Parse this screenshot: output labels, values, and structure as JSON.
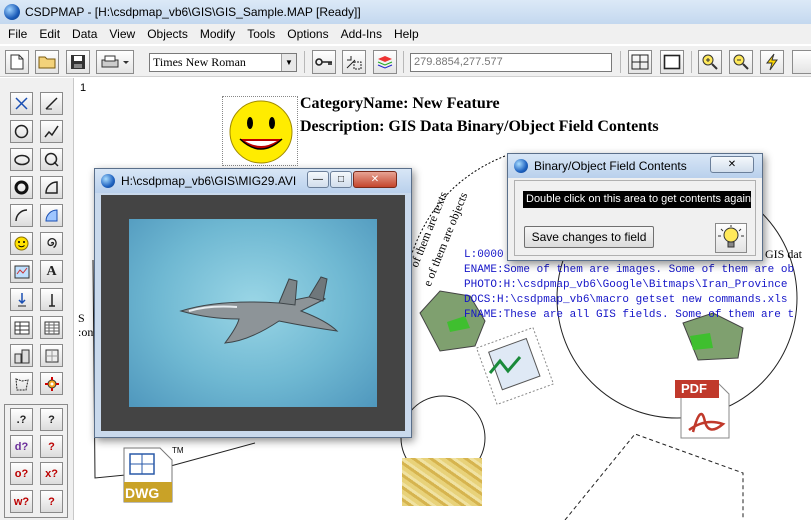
{
  "window": {
    "title": "CSDPMAP - [H:\\csdpmap_vb6\\GIS\\GIS_Sample.MAP [Ready]]"
  },
  "menu": [
    "File",
    "Edit",
    "Data",
    "View",
    "Objects",
    "Modify",
    "Tools",
    "Options",
    "Add-Ins",
    "Help"
  ],
  "toolbar": {
    "font_name": "Times New Roman",
    "coordinates": "279.8854,277.577",
    "buttons": [
      "new-doc-icon",
      "open-folder-icon",
      "save-icon",
      "print-icon",
      "key-icon",
      "select-tool-icon",
      "layers-icon",
      "grid-icon",
      "page-icon",
      "zoom-in-icon",
      "zoom-out-icon",
      "lightning-icon"
    ]
  },
  "palette": {
    "row_icons": [
      "select-x-icon",
      "line-icon",
      "circle-icon",
      "polyline-icon",
      "ellipse-icon",
      "q-shape-icon",
      "ring-icon",
      "arc-fill-icon",
      "arc-icon",
      "protractor-icon",
      "smiley-icon",
      "spiral-icon",
      "map-icon",
      "text-icon",
      "stamp-icon",
      "marker-icon",
      "table-icon",
      "grid-table-icon",
      "buildings-icon",
      "puzzle-icon",
      "polygon-icon",
      "gear-icon"
    ],
    "query_labels": [
      ".?",
      "?",
      "d?",
      "?",
      "o?",
      "x?",
      "w?",
      "?"
    ]
  },
  "canvas": {
    "page_number": "1",
    "category_line": "CategoryName: New Feature",
    "description_line": "Description: GIS Data Binary/Object Field Contents",
    "fields": [
      "L:0000",
      "ENAME:Some of them are images. Some of them are ob",
      "PHOTO:H:\\csdpmap_vb6\\Google\\Bitmaps\\Iran_Province",
      "DOCS:H:\\csdpmap_vb6\\macro getset new commands.xls",
      "FNAME:These are all GIS fields. Some of them are t"
    ],
    "gis_data_label": "GIS dat",
    "slanted_1": "of them are texts",
    "slanted_2": "e of them are objects",
    "side_label_1": "S",
    "side_label_2": ":on",
    "dwg_label": "DWG",
    "dwg_tm": "TM",
    "pdf_label": "PDF"
  },
  "video_window": {
    "title": "H:\\csdpmap_vb6\\GIS\\MIG29.AVI"
  },
  "binary_window": {
    "title": "Binary/Object Field Contents",
    "hint": "Double click on this area to get contents again.",
    "save_button": "Save changes to field"
  }
}
